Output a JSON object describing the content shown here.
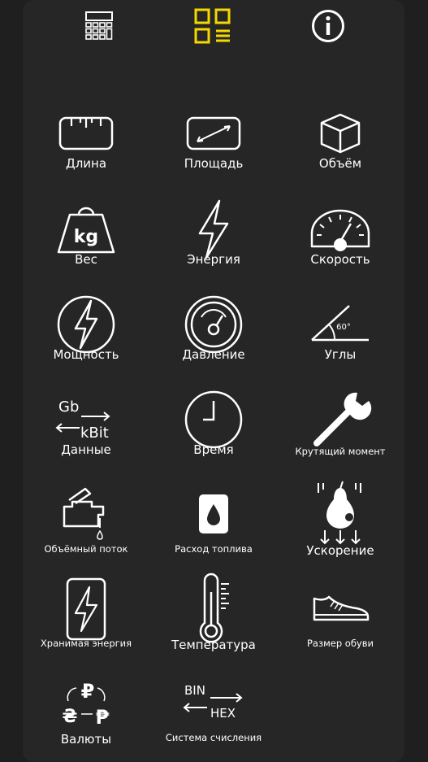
{
  "topbar": {
    "calculator_icon": "calculator-icon",
    "grid_icon": "grid-list-icon",
    "info_icon": "info-icon",
    "accent_color": "#f5d800"
  },
  "categories": [
    {
      "label": "Длина",
      "icon": "ruler-icon"
    },
    {
      "label": "Площадь",
      "icon": "area-icon"
    },
    {
      "label": "Объём",
      "icon": "cube-icon"
    },
    {
      "label": "Вес",
      "icon": "weight-kg-icon",
      "icon_text": "kg"
    },
    {
      "label": "Энергия",
      "icon": "lightning-icon"
    },
    {
      "label": "Скорость",
      "icon": "speedometer-icon"
    },
    {
      "label": "Мощность",
      "icon": "power-circle-icon"
    },
    {
      "label": "Давление",
      "icon": "pressure-gauge-icon"
    },
    {
      "label": "Углы",
      "icon": "angle-icon",
      "icon_text": "60°"
    },
    {
      "label": "Данные",
      "icon": "data-units-icon",
      "icon_text_top": "Gb",
      "icon_text_bottom": "kBit"
    },
    {
      "label": "Время",
      "icon": "clock-icon"
    },
    {
      "label": "Крутящий момент",
      "icon": "wrench-icon"
    },
    {
      "label": "Объёмный поток",
      "icon": "faucet-icon"
    },
    {
      "label": "Расход топлива",
      "icon": "fuel-drop-icon"
    },
    {
      "label": "Ускорение",
      "icon": "falling-pear-icon"
    },
    {
      "label": "Хранимая энергия",
      "icon": "battery-icon"
    },
    {
      "label": "Температура",
      "icon": "thermometer-icon"
    },
    {
      "label": "Размер обуви",
      "icon": "shoe-icon"
    },
    {
      "label": "Валюты",
      "icon": "currency-exchange-icon",
      "icon_text": "₽ ₴ ₱"
    },
    {
      "label": "Система счисления",
      "icon": "numeral-system-icon",
      "icon_text_top": "BIN",
      "icon_text_bottom": "HEX"
    }
  ]
}
